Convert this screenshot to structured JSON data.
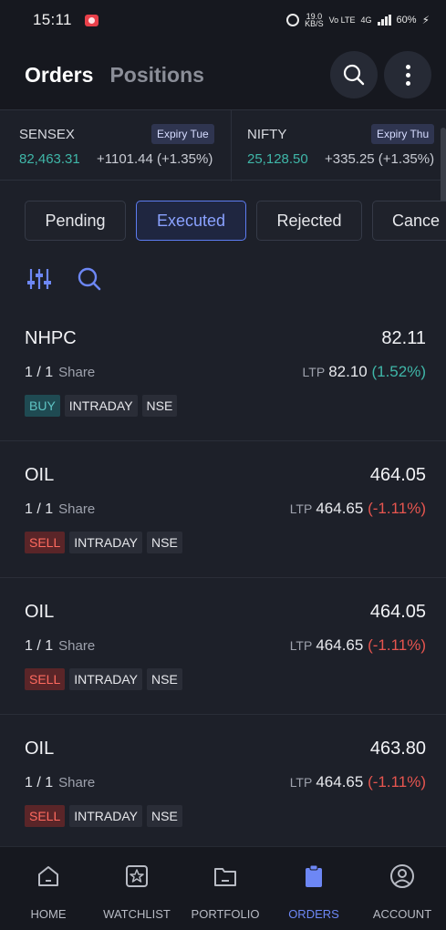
{
  "status": {
    "time": "15:11",
    "net_speed_top": "19.0",
    "net_speed_bottom": "KB/S",
    "network_label": "Vo LTE",
    "network_type": "4G",
    "battery": "60%"
  },
  "header": {
    "active_tab": "Orders",
    "other_tab": "Positions",
    "search_icon": "search-icon",
    "more_icon": "more-vertical-icon"
  },
  "indices": [
    {
      "name": "SENSEX",
      "expiry": "Expiry Tue",
      "value": "82,463.31",
      "change": "+1101.44 (+1.35%)"
    },
    {
      "name": "NIFTY",
      "expiry": "Expiry Thu",
      "value": "25,128.50",
      "change": "+335.25 (+1.35%)"
    }
  ],
  "filter_tabs": [
    "Pending",
    "Executed",
    "Rejected",
    "Cance"
  ],
  "active_filter": "Executed",
  "tools": {
    "filter_icon": "sliders-icon",
    "search_icon": "search-icon"
  },
  "orders": [
    {
      "symbol": "NHPC",
      "price": "82.11",
      "qty": "1 / 1",
      "unit": "Share",
      "ltp_label": "LTP",
      "ltp": "82.10",
      "change": "(1.52%)",
      "direction": "up",
      "side": "BUY",
      "product": "INTRADAY",
      "exchange": "NSE"
    },
    {
      "symbol": "OIL",
      "price": "464.05",
      "qty": "1 / 1",
      "unit": "Share",
      "ltp_label": "LTP",
      "ltp": "464.65",
      "change": "(-1.11%)",
      "direction": "down",
      "side": "SELL",
      "product": "INTRADAY",
      "exchange": "NSE"
    },
    {
      "symbol": "OIL",
      "price": "464.05",
      "qty": "1 / 1",
      "unit": "Share",
      "ltp_label": "LTP",
      "ltp": "464.65",
      "change": "(-1.11%)",
      "direction": "down",
      "side": "SELL",
      "product": "INTRADAY",
      "exchange": "NSE"
    },
    {
      "symbol": "OIL",
      "price": "463.80",
      "qty": "1 / 1",
      "unit": "Share",
      "ltp_label": "LTP",
      "ltp": "464.65",
      "change": "(-1.11%)",
      "direction": "down",
      "side": "SELL",
      "product": "INTRADAY",
      "exchange": "NSE"
    }
  ],
  "bottom_nav": [
    {
      "label": "HOME",
      "icon": "home-icon"
    },
    {
      "label": "WATCHLIST",
      "icon": "star-icon"
    },
    {
      "label": "PORTFOLIO",
      "icon": "folder-icon"
    },
    {
      "label": "ORDERS",
      "icon": "clipboard-icon"
    },
    {
      "label": "ACCOUNT",
      "icon": "user-icon"
    }
  ],
  "active_nav": "ORDERS",
  "colors": {
    "accent": "#6d87f5",
    "positive": "#3fb6a8",
    "negative": "#e7554f",
    "background": "#1d2029"
  }
}
